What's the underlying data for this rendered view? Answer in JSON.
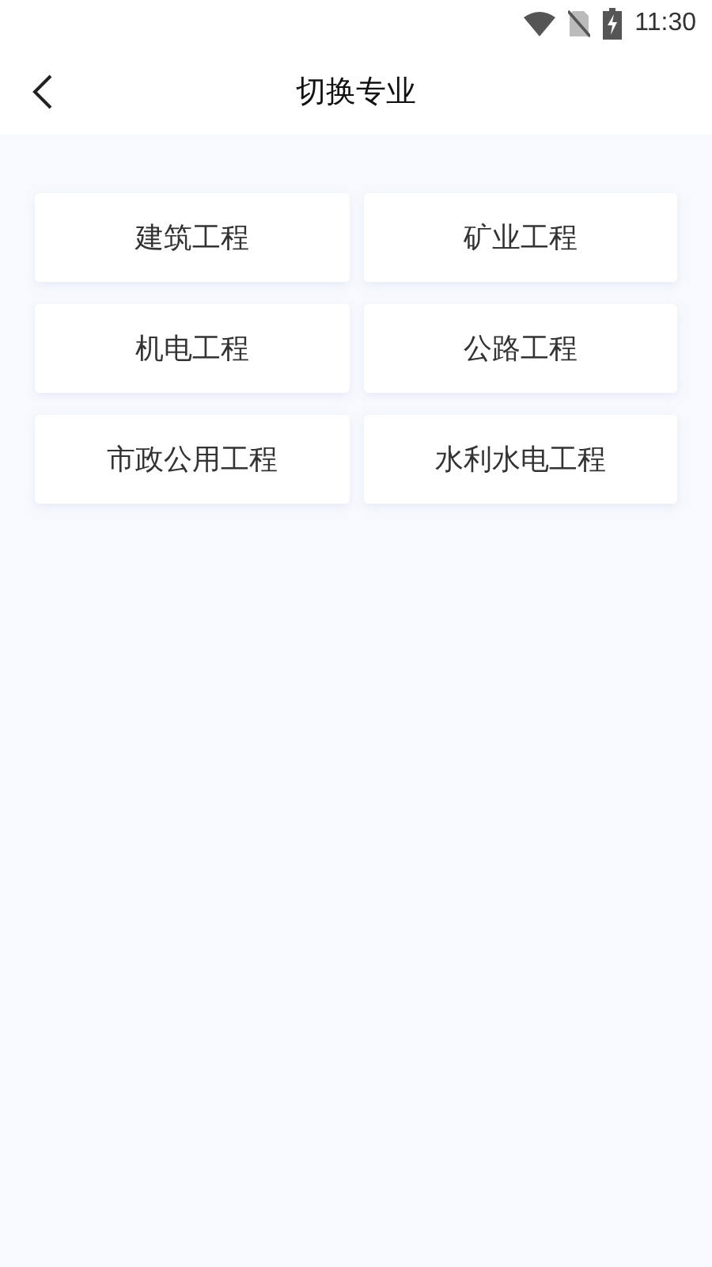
{
  "status_bar": {
    "time": "11:30"
  },
  "header": {
    "title": "切换专业"
  },
  "majors": [
    {
      "label": "建筑工程"
    },
    {
      "label": "矿业工程"
    },
    {
      "label": "机电工程"
    },
    {
      "label": "公路工程"
    },
    {
      "label": "市政公用工程"
    },
    {
      "label": "水利水电工程"
    }
  ]
}
